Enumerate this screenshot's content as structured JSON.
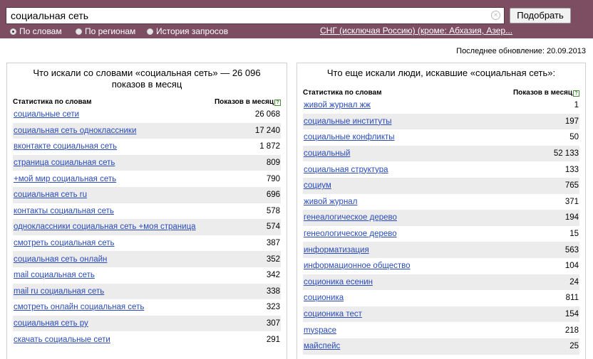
{
  "search": {
    "value": "социальная сеть",
    "button_label": "Подобрать"
  },
  "modes": [
    {
      "label": "По словам",
      "checked": true
    },
    {
      "label": "По регионам",
      "checked": false
    },
    {
      "label": "История запросов",
      "checked": false
    }
  ],
  "region": "СНГ (исключая Россию) (кроме: Абхазия, Азер...",
  "last_update": "Последнее обновление: 20.09.2013",
  "left": {
    "title": "Что искали со словами «социальная сеть» — 26 096 показов в месяц",
    "col_phrase": "Статистика по словам",
    "col_count": "Показов в месяц",
    "help": "?",
    "rows": [
      {
        "phrase": "социальные сети",
        "count": "26 068"
      },
      {
        "phrase": "социальная сеть одноклассники",
        "count": "17 240"
      },
      {
        "phrase": "вконтакте социальная сеть",
        "count": "1 872"
      },
      {
        "phrase": "страница социальная сеть",
        "count": "809"
      },
      {
        "phrase": "+мой мир социальная сеть",
        "count": "790"
      },
      {
        "phrase": "социальная сеть ru",
        "count": "696"
      },
      {
        "phrase": "контакты социальная сеть",
        "count": "578"
      },
      {
        "phrase": "одноклассники социальная сеть +моя страница",
        "count": "574"
      },
      {
        "phrase": "смотреть социальная сеть",
        "count": "387"
      },
      {
        "phrase": "социальная сеть онлайн",
        "count": "352"
      },
      {
        "phrase": "mail социальная сеть",
        "count": "342"
      },
      {
        "phrase": "mail ru социальная сеть",
        "count": "338"
      },
      {
        "phrase": "смотреть онлайн социальная сеть",
        "count": "323"
      },
      {
        "phrase": "социальная сеть ру",
        "count": "307"
      },
      {
        "phrase": "скачать социальные сети",
        "count": "291"
      }
    ]
  },
  "right": {
    "title": "Что еще искали люди, искавшие «социальная сеть»:",
    "col_phrase": "Статистика по словам",
    "col_count": "Показов в месяц",
    "help": "?",
    "rows": [
      {
        "phrase": "живой журнал жж",
        "count": "1"
      },
      {
        "phrase": "социальные институты",
        "count": "197"
      },
      {
        "phrase": "социальные конфликты",
        "count": "50"
      },
      {
        "phrase": "социальный",
        "count": "52 133"
      },
      {
        "phrase": "социальная структура",
        "count": "133"
      },
      {
        "phrase": "социум",
        "count": "765"
      },
      {
        "phrase": "живой журнал",
        "count": "371"
      },
      {
        "phrase": "генеалогическое дерево",
        "count": "194"
      },
      {
        "phrase": "генеологическое дерево",
        "count": "15"
      },
      {
        "phrase": "информатизация",
        "count": "563"
      },
      {
        "phrase": "информационное общество",
        "count": "104"
      },
      {
        "phrase": "соционика есенин",
        "count": "24"
      },
      {
        "phrase": "соционика",
        "count": "811"
      },
      {
        "phrase": "соционика тест",
        "count": "154"
      },
      {
        "phrase": "myspace",
        "count": "218"
      },
      {
        "phrase": "майспейс",
        "count": "25"
      }
    ]
  }
}
